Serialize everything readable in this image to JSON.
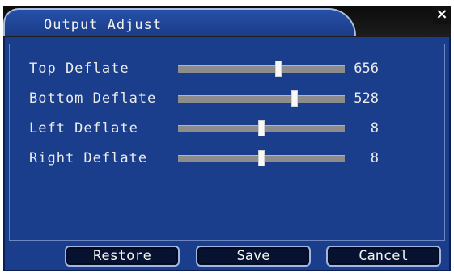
{
  "window": {
    "title": "Output Adjust",
    "close_label": "×"
  },
  "sliders": [
    {
      "label": "Top Deflate",
      "value": "656",
      "level": 0.6
    },
    {
      "label": "Bottom Deflate",
      "value": "528",
      "level": 0.7
    },
    {
      "label": "Left Deflate",
      "value": "8",
      "level": 0.5
    },
    {
      "label": "Right Deflate",
      "value": "8",
      "level": 0.5
    }
  ],
  "buttons": {
    "restore": "Restore",
    "save": "Save",
    "cancel": "Cancel"
  }
}
